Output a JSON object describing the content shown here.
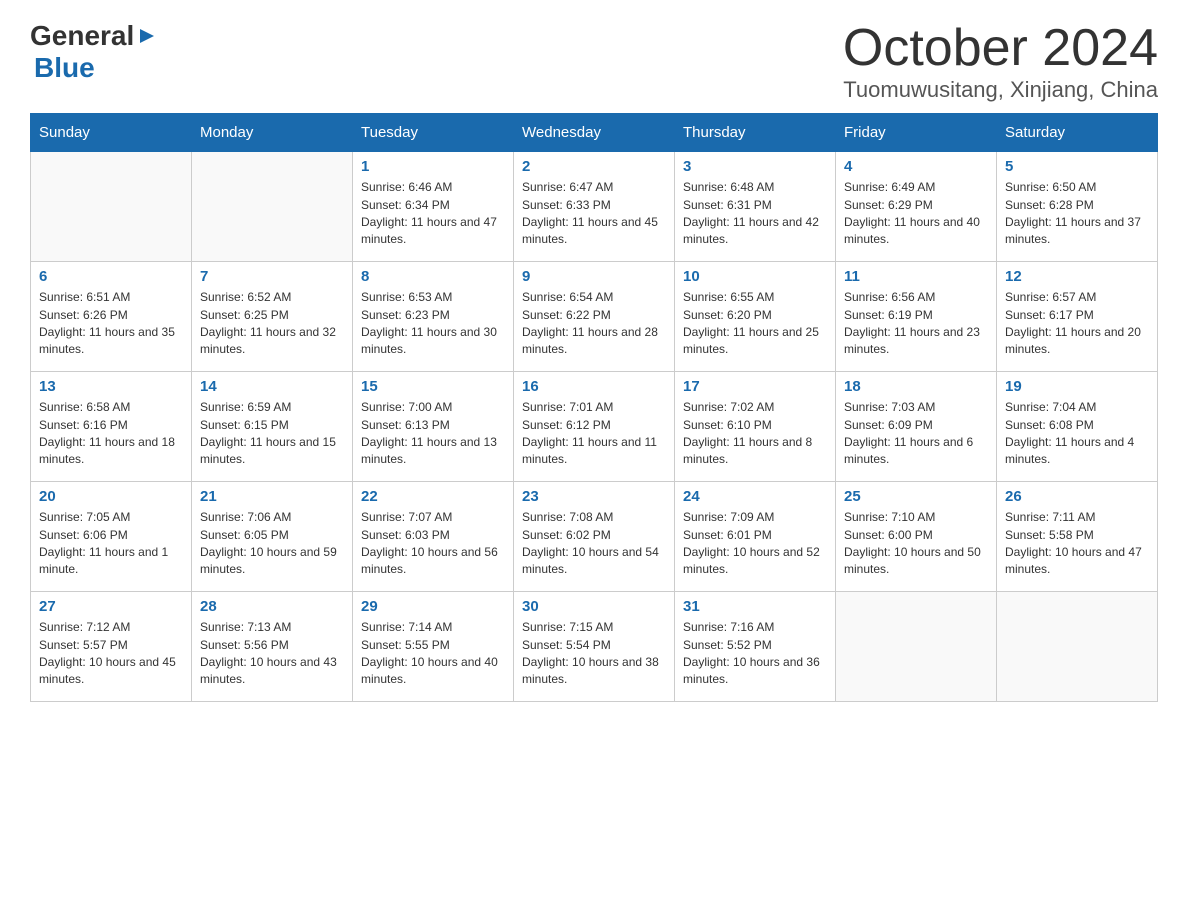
{
  "header": {
    "logo_general": "General",
    "logo_blue": "Blue",
    "month_title": "October 2024",
    "location": "Tuomuwusitang, Xinjiang, China"
  },
  "weekdays": [
    "Sunday",
    "Monday",
    "Tuesday",
    "Wednesday",
    "Thursday",
    "Friday",
    "Saturday"
  ],
  "weeks": [
    [
      {
        "day": "",
        "sunrise": "",
        "sunset": "",
        "daylight": ""
      },
      {
        "day": "",
        "sunrise": "",
        "sunset": "",
        "daylight": ""
      },
      {
        "day": "1",
        "sunrise": "Sunrise: 6:46 AM",
        "sunset": "Sunset: 6:34 PM",
        "daylight": "Daylight: 11 hours and 47 minutes."
      },
      {
        "day": "2",
        "sunrise": "Sunrise: 6:47 AM",
        "sunset": "Sunset: 6:33 PM",
        "daylight": "Daylight: 11 hours and 45 minutes."
      },
      {
        "day": "3",
        "sunrise": "Sunrise: 6:48 AM",
        "sunset": "Sunset: 6:31 PM",
        "daylight": "Daylight: 11 hours and 42 minutes."
      },
      {
        "day": "4",
        "sunrise": "Sunrise: 6:49 AM",
        "sunset": "Sunset: 6:29 PM",
        "daylight": "Daylight: 11 hours and 40 minutes."
      },
      {
        "day": "5",
        "sunrise": "Sunrise: 6:50 AM",
        "sunset": "Sunset: 6:28 PM",
        "daylight": "Daylight: 11 hours and 37 minutes."
      }
    ],
    [
      {
        "day": "6",
        "sunrise": "Sunrise: 6:51 AM",
        "sunset": "Sunset: 6:26 PM",
        "daylight": "Daylight: 11 hours and 35 minutes."
      },
      {
        "day": "7",
        "sunrise": "Sunrise: 6:52 AM",
        "sunset": "Sunset: 6:25 PM",
        "daylight": "Daylight: 11 hours and 32 minutes."
      },
      {
        "day": "8",
        "sunrise": "Sunrise: 6:53 AM",
        "sunset": "Sunset: 6:23 PM",
        "daylight": "Daylight: 11 hours and 30 minutes."
      },
      {
        "day": "9",
        "sunrise": "Sunrise: 6:54 AM",
        "sunset": "Sunset: 6:22 PM",
        "daylight": "Daylight: 11 hours and 28 minutes."
      },
      {
        "day": "10",
        "sunrise": "Sunrise: 6:55 AM",
        "sunset": "Sunset: 6:20 PM",
        "daylight": "Daylight: 11 hours and 25 minutes."
      },
      {
        "day": "11",
        "sunrise": "Sunrise: 6:56 AM",
        "sunset": "Sunset: 6:19 PM",
        "daylight": "Daylight: 11 hours and 23 minutes."
      },
      {
        "day": "12",
        "sunrise": "Sunrise: 6:57 AM",
        "sunset": "Sunset: 6:17 PM",
        "daylight": "Daylight: 11 hours and 20 minutes."
      }
    ],
    [
      {
        "day": "13",
        "sunrise": "Sunrise: 6:58 AM",
        "sunset": "Sunset: 6:16 PM",
        "daylight": "Daylight: 11 hours and 18 minutes."
      },
      {
        "day": "14",
        "sunrise": "Sunrise: 6:59 AM",
        "sunset": "Sunset: 6:15 PM",
        "daylight": "Daylight: 11 hours and 15 minutes."
      },
      {
        "day": "15",
        "sunrise": "Sunrise: 7:00 AM",
        "sunset": "Sunset: 6:13 PM",
        "daylight": "Daylight: 11 hours and 13 minutes."
      },
      {
        "day": "16",
        "sunrise": "Sunrise: 7:01 AM",
        "sunset": "Sunset: 6:12 PM",
        "daylight": "Daylight: 11 hours and 11 minutes."
      },
      {
        "day": "17",
        "sunrise": "Sunrise: 7:02 AM",
        "sunset": "Sunset: 6:10 PM",
        "daylight": "Daylight: 11 hours and 8 minutes."
      },
      {
        "day": "18",
        "sunrise": "Sunrise: 7:03 AM",
        "sunset": "Sunset: 6:09 PM",
        "daylight": "Daylight: 11 hours and 6 minutes."
      },
      {
        "day": "19",
        "sunrise": "Sunrise: 7:04 AM",
        "sunset": "Sunset: 6:08 PM",
        "daylight": "Daylight: 11 hours and 4 minutes."
      }
    ],
    [
      {
        "day": "20",
        "sunrise": "Sunrise: 7:05 AM",
        "sunset": "Sunset: 6:06 PM",
        "daylight": "Daylight: 11 hours and 1 minute."
      },
      {
        "day": "21",
        "sunrise": "Sunrise: 7:06 AM",
        "sunset": "Sunset: 6:05 PM",
        "daylight": "Daylight: 10 hours and 59 minutes."
      },
      {
        "day": "22",
        "sunrise": "Sunrise: 7:07 AM",
        "sunset": "Sunset: 6:03 PM",
        "daylight": "Daylight: 10 hours and 56 minutes."
      },
      {
        "day": "23",
        "sunrise": "Sunrise: 7:08 AM",
        "sunset": "Sunset: 6:02 PM",
        "daylight": "Daylight: 10 hours and 54 minutes."
      },
      {
        "day": "24",
        "sunrise": "Sunrise: 7:09 AM",
        "sunset": "Sunset: 6:01 PM",
        "daylight": "Daylight: 10 hours and 52 minutes."
      },
      {
        "day": "25",
        "sunrise": "Sunrise: 7:10 AM",
        "sunset": "Sunset: 6:00 PM",
        "daylight": "Daylight: 10 hours and 50 minutes."
      },
      {
        "day": "26",
        "sunrise": "Sunrise: 7:11 AM",
        "sunset": "Sunset: 5:58 PM",
        "daylight": "Daylight: 10 hours and 47 minutes."
      }
    ],
    [
      {
        "day": "27",
        "sunrise": "Sunrise: 7:12 AM",
        "sunset": "Sunset: 5:57 PM",
        "daylight": "Daylight: 10 hours and 45 minutes."
      },
      {
        "day": "28",
        "sunrise": "Sunrise: 7:13 AM",
        "sunset": "Sunset: 5:56 PM",
        "daylight": "Daylight: 10 hours and 43 minutes."
      },
      {
        "day": "29",
        "sunrise": "Sunrise: 7:14 AM",
        "sunset": "Sunset: 5:55 PM",
        "daylight": "Daylight: 10 hours and 40 minutes."
      },
      {
        "day": "30",
        "sunrise": "Sunrise: 7:15 AM",
        "sunset": "Sunset: 5:54 PM",
        "daylight": "Daylight: 10 hours and 38 minutes."
      },
      {
        "day": "31",
        "sunrise": "Sunrise: 7:16 AM",
        "sunset": "Sunset: 5:52 PM",
        "daylight": "Daylight: 10 hours and 36 minutes."
      },
      {
        "day": "",
        "sunrise": "",
        "sunset": "",
        "daylight": ""
      },
      {
        "day": "",
        "sunrise": "",
        "sunset": "",
        "daylight": ""
      }
    ]
  ]
}
